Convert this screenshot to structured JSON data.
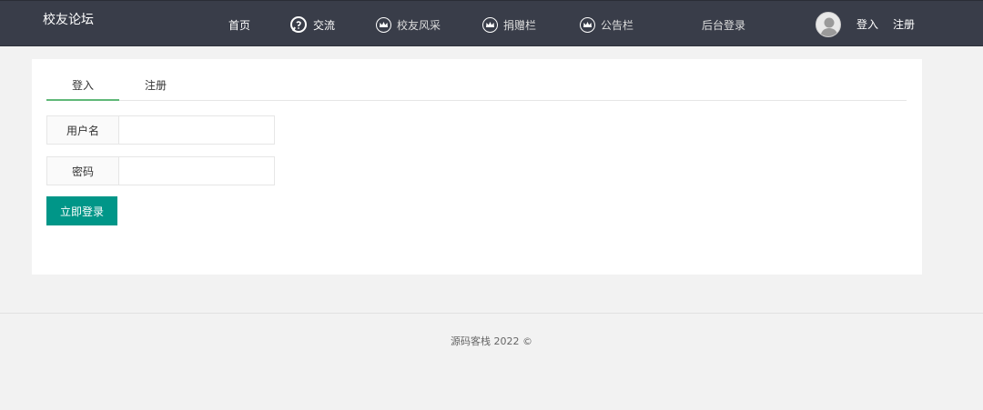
{
  "header": {
    "brand": "校友论坛",
    "nav": [
      {
        "label": "首页",
        "icon": null
      },
      {
        "label": "交流",
        "icon": "chat-bubble-icon"
      },
      {
        "label": "校友风采",
        "icon": "crown-icon"
      },
      {
        "label": "捐赠栏",
        "icon": "crown-icon"
      },
      {
        "label": "公告栏",
        "icon": "crown-icon"
      },
      {
        "label": "后台登录",
        "icon": null
      }
    ],
    "user": {
      "avatar_icon": "user-avatar-icon",
      "login": "登入",
      "register": "注册"
    }
  },
  "login": {
    "tabs": [
      "登入",
      "注册"
    ],
    "active_tab": 0,
    "username_label": "用户名",
    "username_value": "",
    "password_label": "密码",
    "password_value": "",
    "submit": "立即登录"
  },
  "footer": {
    "text": "源码客栈   2022 ©"
  },
  "colors": {
    "topbar": "#393d49",
    "accent": "#009688",
    "tab_underline": "#5fb878",
    "background": "#f2f2f2"
  }
}
